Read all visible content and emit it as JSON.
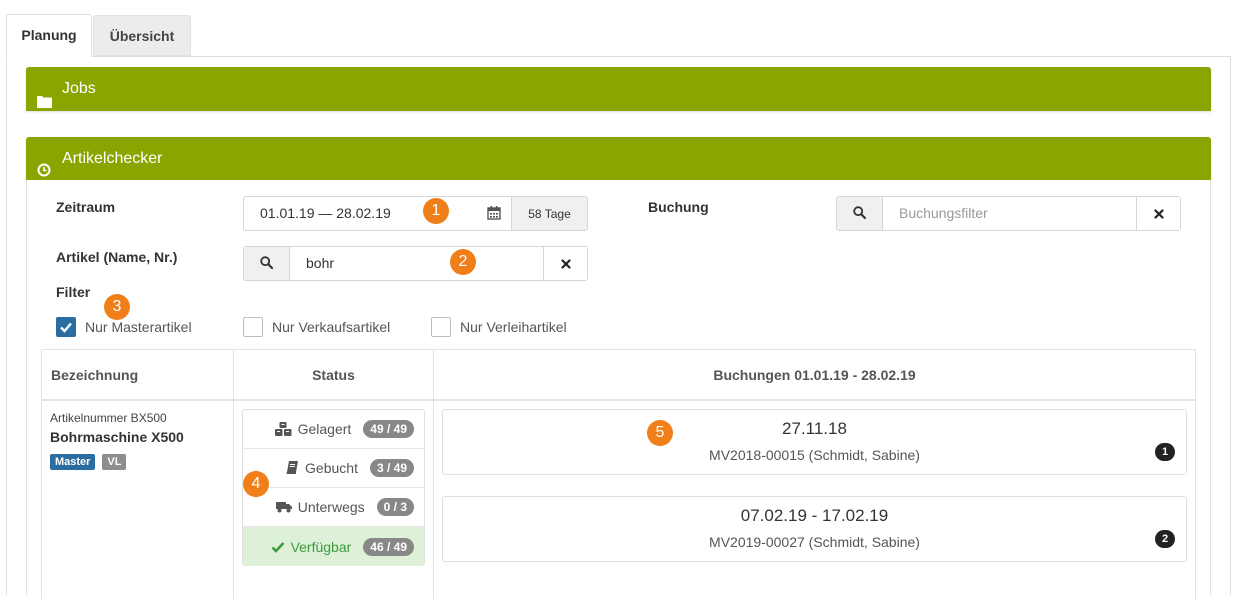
{
  "tabs": [
    {
      "label": "Planung",
      "active": true
    },
    {
      "label": "Übersicht",
      "active": false
    }
  ],
  "panels": {
    "jobs": {
      "title": "Jobs",
      "icon": "folder-icon"
    },
    "articlechecker": {
      "title": "Artikelchecker",
      "icon": "clock-icon"
    }
  },
  "filters": {
    "period": {
      "label": "Zeitraum",
      "value": "01.01.19 — 28.02.19",
      "days": "58 Tage",
      "icon": "calendar-icon"
    },
    "booking": {
      "label": "Buchung",
      "placeholder": "Buchungsfilter"
    },
    "article": {
      "label": "Artikel (Name, Nr.)",
      "value": "bohr"
    },
    "filter_label": "Filter",
    "checkboxes": [
      {
        "label": "Nur Masterartikel",
        "checked": true
      },
      {
        "label": "Nur Verkaufsartikel",
        "checked": false
      },
      {
        "label": "Nur Verleihartikel",
        "checked": false
      }
    ]
  },
  "callouts": [
    "1",
    "2",
    "3",
    "4",
    "5"
  ],
  "table": {
    "headers": {
      "name": "Bezeichnung",
      "status": "Status",
      "bookings": "Buchungen 01.01.19 - 28.02.19"
    },
    "rows": [
      {
        "article_number": "Artikelnummer BX500",
        "article_name": "Bohrmaschine X500",
        "tags": [
          "Master",
          "VL"
        ],
        "status": [
          {
            "label": "Gelagert",
            "count": "49 / 49",
            "icon": "cubes-icon"
          },
          {
            "label": "Gebucht",
            "count": "3 / 49",
            "icon": "book-icon"
          },
          {
            "label": "Unterwegs",
            "count": "0 / 3",
            "icon": "truck-icon"
          },
          {
            "label": "Verfügbar",
            "count": "46 / 49",
            "icon": "check-icon"
          }
        ],
        "bookings": [
          {
            "date": "27.11.18",
            "ref": "MV2018-00015 (Schmidt, Sabine)",
            "count": "1"
          },
          {
            "date": "07.02.19 - 17.02.19",
            "ref": "MV2019-00027 (Schmidt, Sabine)",
            "count": "2"
          }
        ]
      }
    ]
  },
  "colors": {
    "accent_green": "#8ba400",
    "callout_orange": "#f07f19",
    "checkbox_blue": "#2b6da0",
    "tag_master": "#2b6da0",
    "tag_vl": "#8e8e8e",
    "available_bg": "#dff0d8",
    "available_text": "#3c9a3c"
  }
}
